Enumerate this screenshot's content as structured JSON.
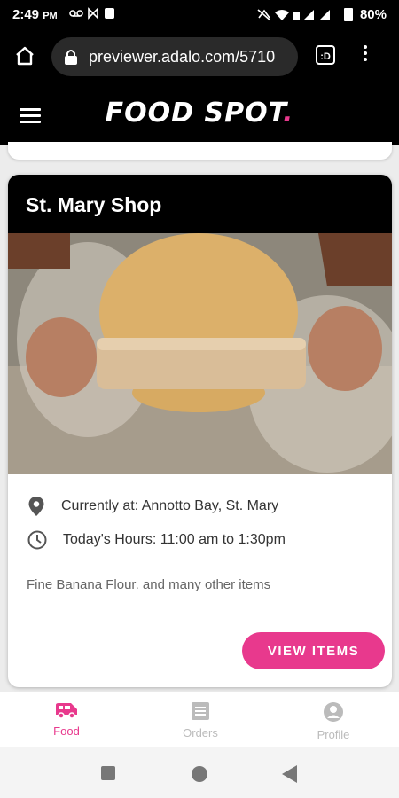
{
  "status": {
    "time": "2:49",
    "ampm": "PM",
    "battery": "80%"
  },
  "browser": {
    "url": "previewer.adalo.com/5710",
    "tab_symbol": ":D"
  },
  "app": {
    "logo_text": "FOOD SPOT",
    "logo_dot": "."
  },
  "shop": {
    "name": "St. Mary Shop",
    "location": "Currently at: Annotto Bay, St. Mary",
    "hours": "Today's Hours: 11:00 am to 1:30pm",
    "description": "Fine Banana Flour. and many other items",
    "button_label": "VIEW ITEMS"
  },
  "nav": [
    {
      "label": "Food",
      "icon": "van-icon",
      "active": true
    },
    {
      "label": "Orders",
      "icon": "list-icon",
      "active": false
    },
    {
      "label": "Profile",
      "icon": "account-icon",
      "active": false
    }
  ],
  "colors": {
    "accent": "#e8398d",
    "header_bg": "#000000",
    "page_bg": "#ececec"
  }
}
